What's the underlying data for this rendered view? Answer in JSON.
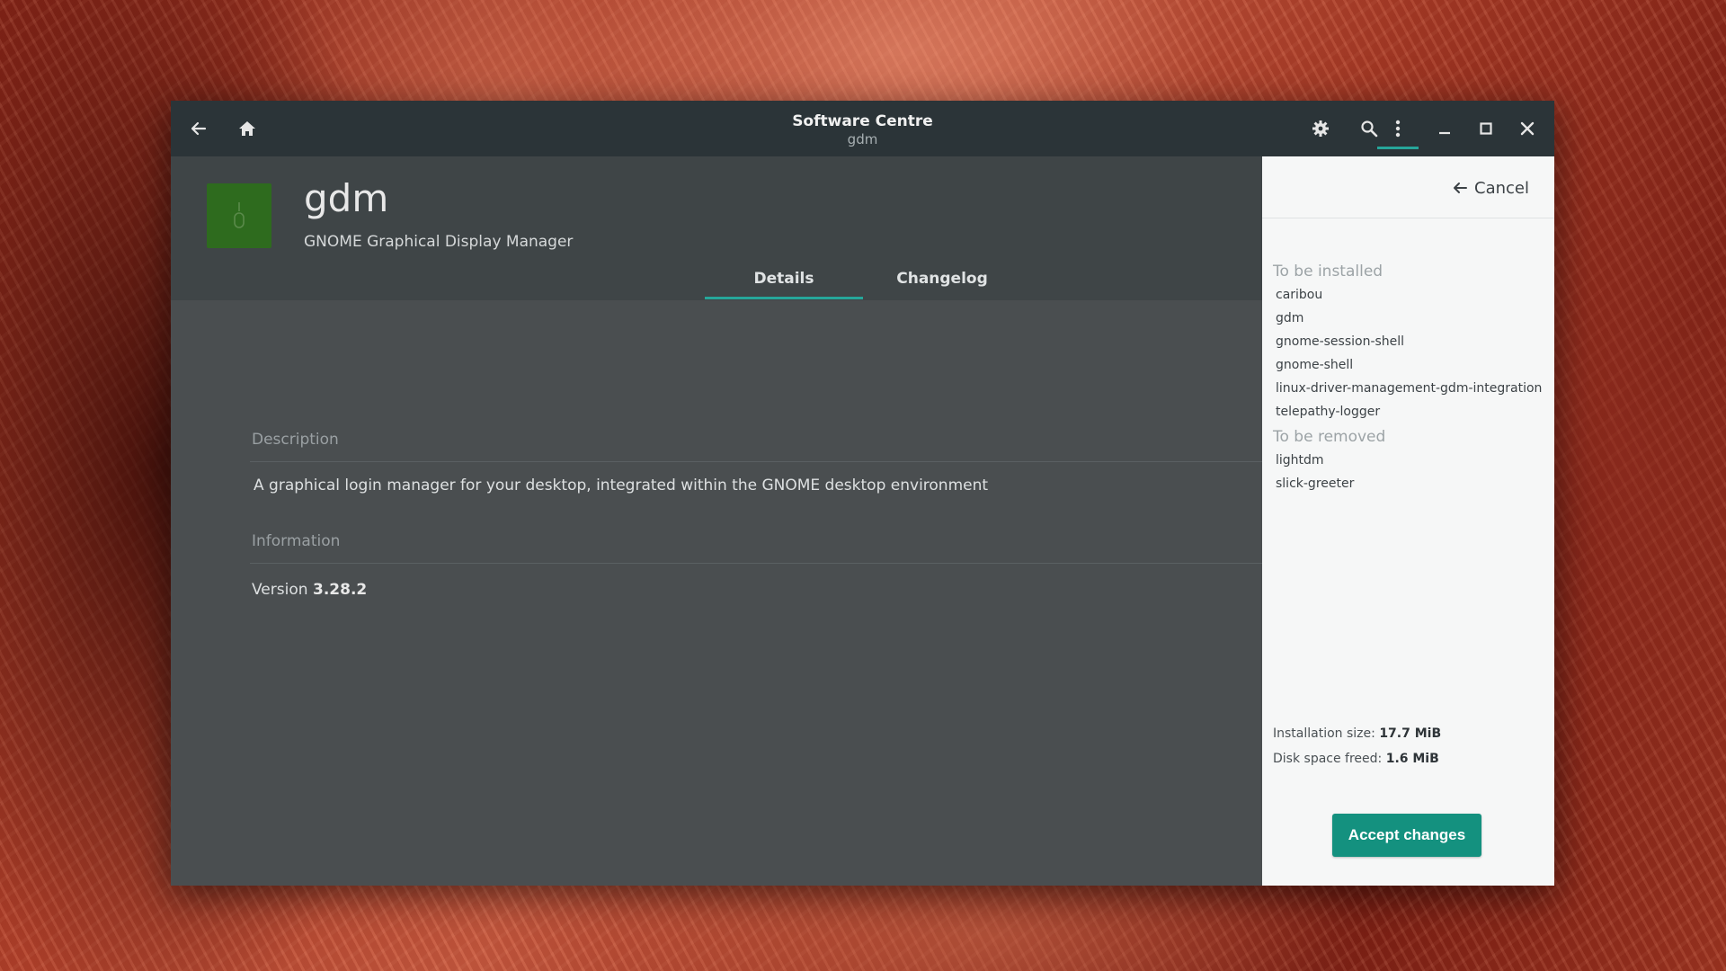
{
  "window": {
    "title": "Software Centre",
    "subtitle": "gdm"
  },
  "titlebar": {
    "icons": [
      "back-arrow-icon",
      "home-icon",
      "gear-icon",
      "search-icon",
      "more-vertical-icon",
      "minimize-icon",
      "maximize-icon",
      "close-icon"
    ]
  },
  "app": {
    "name": "gdm",
    "summary": "GNOME Graphical Display Manager",
    "icon_color": "#2e6b1e"
  },
  "tabs": [
    {
      "label": "Details",
      "active": true
    },
    {
      "label": "Changelog",
      "active": false
    }
  ],
  "details": {
    "description_label": "Description",
    "description_text": "A graphical login manager for your desktop, integrated within the GNOME desktop environment",
    "information_label": "Information",
    "version_label": "Version",
    "version_value": "3.28.2"
  },
  "changes_panel": {
    "cancel_label": "Cancel",
    "to_install_title": "To be installed",
    "to_install": [
      "caribou",
      "gdm",
      "gnome-session-shell",
      "gnome-shell",
      "linux-driver-management-gdm-integration",
      "telepathy-logger"
    ],
    "to_remove_title": "To be removed",
    "to_remove": [
      "lightdm",
      "slick-greeter"
    ],
    "install_size_label": "Installation size:",
    "install_size_value": "17.7 MiB",
    "freed_label": "Disk space freed:",
    "freed_value": "1.6 MiB",
    "accept_label": "Accept changes"
  },
  "colors": {
    "accent": "#26a69a",
    "accept_button": "#14917f",
    "titlebar": "#2b3438"
  }
}
